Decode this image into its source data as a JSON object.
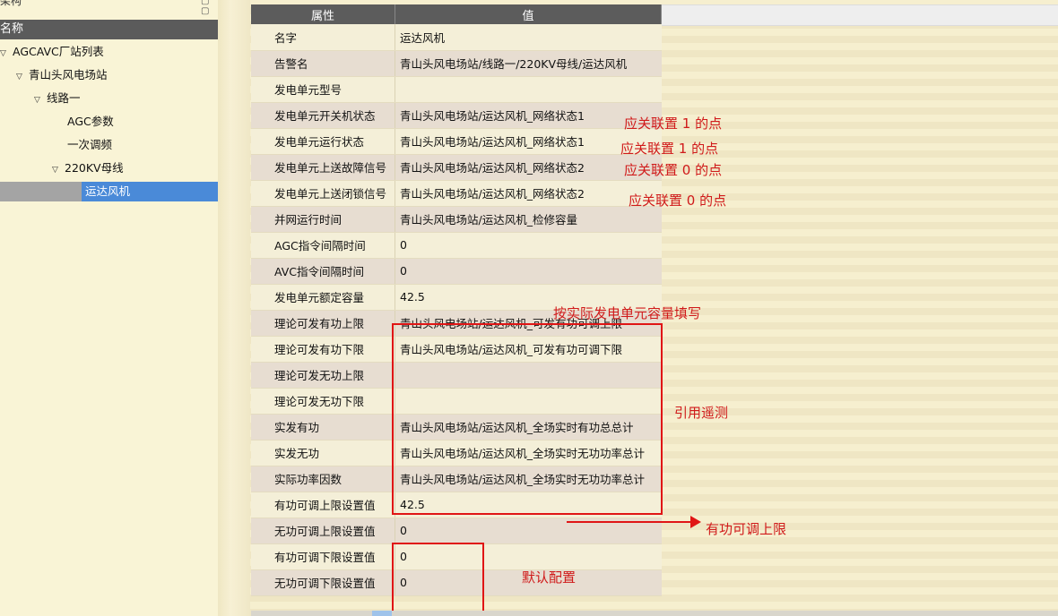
{
  "left_panel": {
    "title": "架构",
    "tools": "▢ ▢",
    "header": "名称",
    "tree": [
      {
        "label": "AGCAVC厂站列表",
        "expanded": true,
        "level": 0
      },
      {
        "label": "青山头风电场站",
        "expanded": true,
        "level": 1
      },
      {
        "label": "线路一",
        "expanded": true,
        "level": 2
      },
      {
        "label": "AGC参数",
        "expanded": null,
        "level": 3
      },
      {
        "label": "一次调频",
        "expanded": null,
        "level": 3
      },
      {
        "label": "220KV母线",
        "expanded": true,
        "level": 3
      },
      {
        "label": "运达风机",
        "expanded": null,
        "level": 4,
        "selected": true
      }
    ]
  },
  "table": {
    "col_key": "属性",
    "col_value": "值",
    "rows": [
      {
        "k": "名字",
        "v": "运达风机"
      },
      {
        "k": "告警名",
        "v": "青山头风电场站/线路一/220KV母线/运达风机"
      },
      {
        "k": "发电单元型号",
        "v": ""
      },
      {
        "k": "发电单元开关机状态",
        "v": "青山头风电场站/运达风机_网络状态1"
      },
      {
        "k": "发电单元运行状态",
        "v": "青山头风电场站/运达风机_网络状态1"
      },
      {
        "k": "发电单元上送故障信号",
        "v": "青山头风电场站/运达风机_网络状态2"
      },
      {
        "k": "发电单元上送闭锁信号",
        "v": "青山头风电场站/运达风机_网络状态2"
      },
      {
        "k": "并网运行时间",
        "v": "青山头风电场站/运达风机_检修容量"
      },
      {
        "k": "AGC指令间隔时间",
        "v": "0"
      },
      {
        "k": "AVC指令间隔时间",
        "v": "0"
      },
      {
        "k": "发电单元额定容量",
        "v": "42.5"
      },
      {
        "k": "理论可发有功上限",
        "v": "青山头风电场站/运达风机_可发有功可调上限"
      },
      {
        "k": "理论可发有功下限",
        "v": "青山头风电场站/运达风机_可发有功可调下限"
      },
      {
        "k": "理论可发无功上限",
        "v": ""
      },
      {
        "k": "理论可发无功下限",
        "v": ""
      },
      {
        "k": "实发有功",
        "v": "青山头风电场站/运达风机_全场实时有功总总计"
      },
      {
        "k": "实发无功",
        "v": "青山头风电场站/运达风机_全场实时无功功率总计"
      },
      {
        "k": "实际功率因数",
        "v": "青山头风电场站/运达风机_全场实时无功功率总计"
      },
      {
        "k": "有功可调上限设置值",
        "v": "42.5"
      },
      {
        "k": "无功可调上限设置值",
        "v": "0"
      },
      {
        "k": "有功可调下限设置值",
        "v": "0"
      },
      {
        "k": "无功可调下限设置值",
        "v": "0"
      }
    ]
  },
  "annotations": {
    "n1": "应关联置 1 的点",
    "n2": "应关联置 1 的点",
    "n3": "应关联置 0 的点",
    "n4": "应关联置 0 的点",
    "capacity": "按实际发电单元容量填写",
    "telemetry": "引用遥测",
    "upper": "有功可调上限",
    "default": "默认配置",
    "color": "#e01515"
  }
}
